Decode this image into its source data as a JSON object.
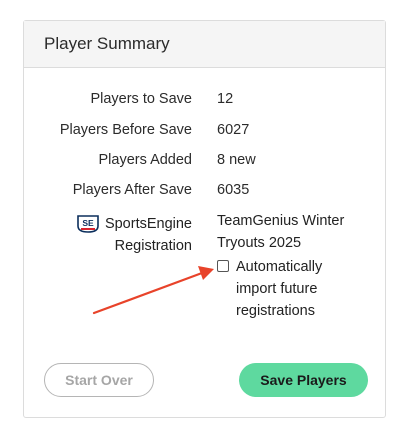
{
  "card": {
    "title": "Player Summary"
  },
  "summary": {
    "rows": [
      {
        "label": "Players to Save",
        "value": "12"
      },
      {
        "label": "Players Before Save",
        "value": "6027"
      },
      {
        "label": "Players Added",
        "value": "8 new"
      },
      {
        "label": "Players After Save",
        "value": "6035"
      }
    ]
  },
  "registration": {
    "brand_label": "SportsEngine",
    "label_line2": "Registration",
    "logo_text": "SE",
    "value_line1": "TeamGenius Winter",
    "value_line2": "Tryouts 2025",
    "auto_import_label": "Automatically import future registrations",
    "auto_import_checked": false
  },
  "actions": {
    "start_over_label": "Start Over",
    "save_label": "Save Players"
  },
  "colors": {
    "save_button": "#5ed99f",
    "arrow": "#e8432a",
    "header_bg": "#f5f5f5"
  }
}
